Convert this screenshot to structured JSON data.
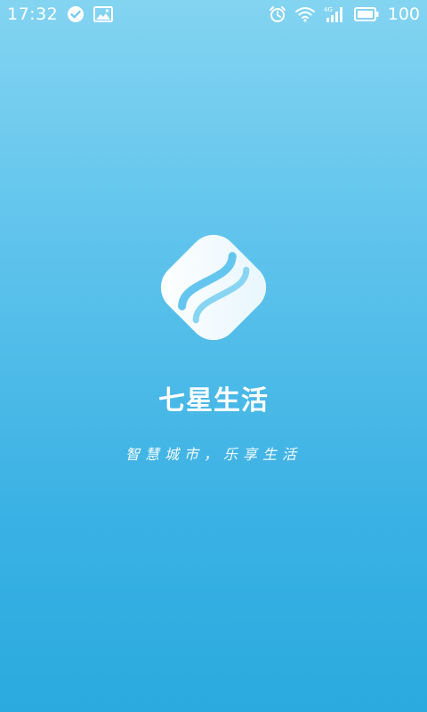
{
  "status_bar": {
    "time": "17:32",
    "battery_level": "100",
    "icons": [
      "check-circle-icon",
      "image-icon",
      "alarm-icon",
      "wifi-icon",
      "4g-signal-icon",
      "battery-icon"
    ],
    "network_label": "4G"
  },
  "splash": {
    "app_name": "七星生活",
    "slogan": "智慧城市，乐享生活"
  },
  "colors": {
    "gradient_top": "#83d4f1",
    "gradient_bottom": "#2aaadf",
    "foreground": "#ffffff"
  }
}
